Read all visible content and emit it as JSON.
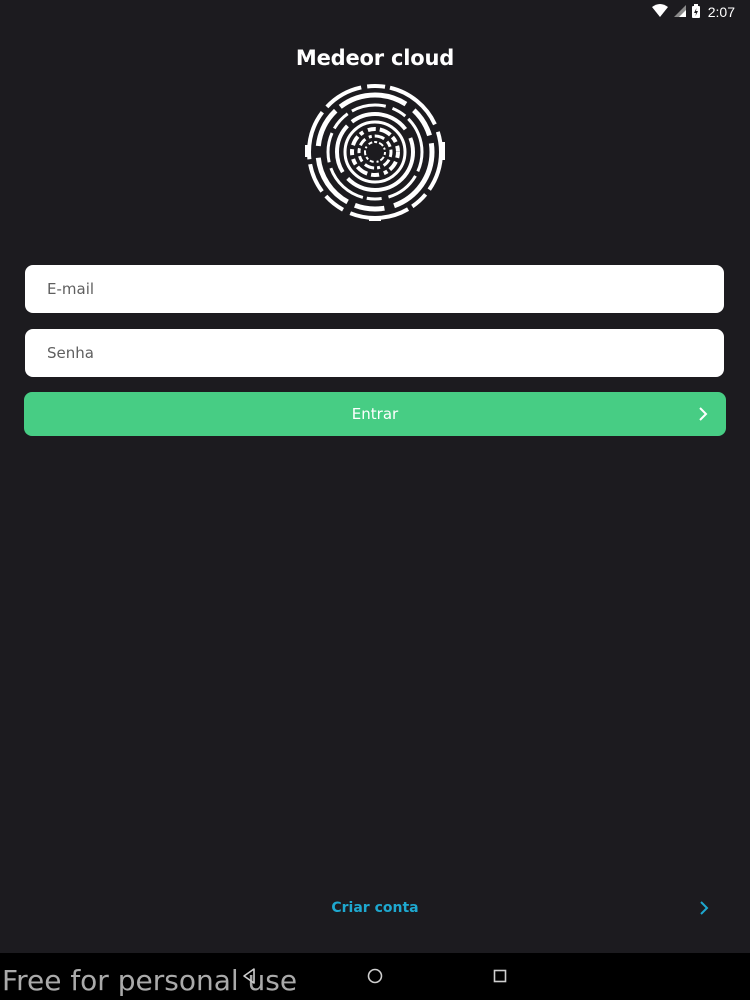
{
  "status_bar": {
    "time": "2:07",
    "icons": [
      "wifi-icon",
      "signal-icon",
      "battery-charging-icon"
    ]
  },
  "app": {
    "title": "Medeor cloud"
  },
  "login_form": {
    "email_placeholder": "E-mail",
    "password_placeholder": "Senha",
    "submit_label": "Entrar"
  },
  "footer": {
    "create_account_label": "Criar conta"
  },
  "nav_bar": {
    "buttons": [
      "back-icon",
      "home-icon",
      "recent-apps-icon"
    ]
  },
  "watermark": "Free for personal use",
  "colors": {
    "background": "#1c1b1f",
    "primary_button": "#47cd84",
    "link": "#1ea8cf",
    "field": "#ffffff"
  }
}
